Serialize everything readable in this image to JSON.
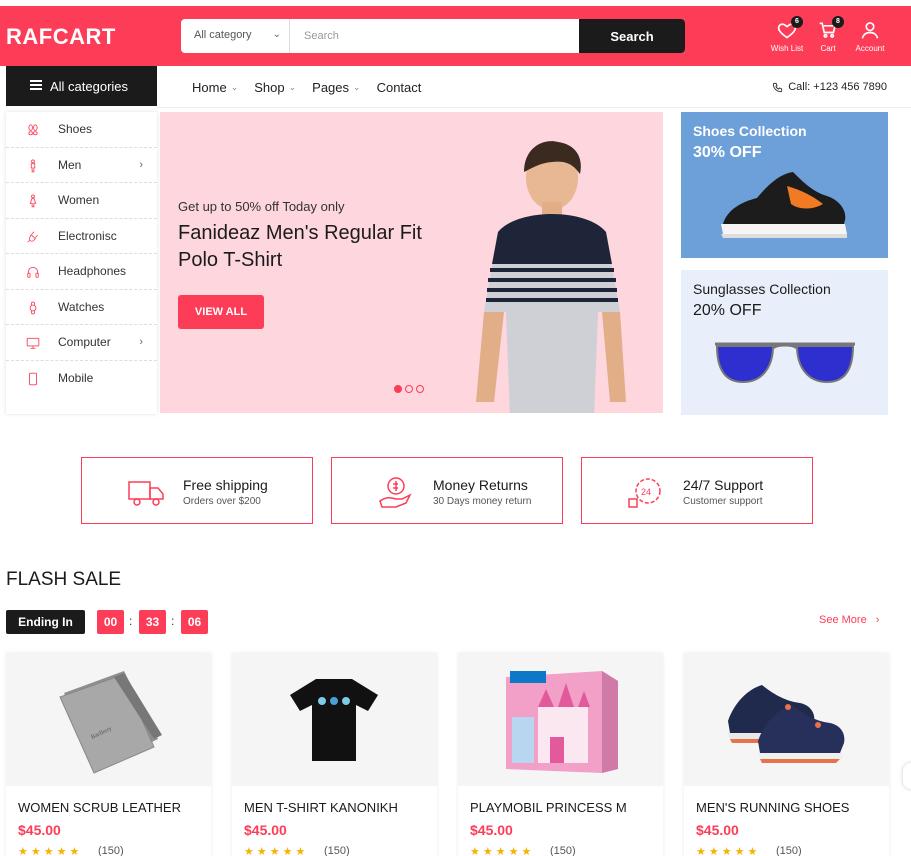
{
  "header": {
    "logo": "RAFCART",
    "category_select": "All category",
    "search_placeholder": "Search",
    "search_button": "Search",
    "wishlist": {
      "label": "Wish List",
      "count": "6"
    },
    "cart": {
      "label": "Cart",
      "count": "8"
    },
    "account": {
      "label": "Account"
    }
  },
  "nav": {
    "all_categories": "All categories",
    "items": [
      "Home",
      "Shop",
      "Pages",
      "Contact"
    ],
    "phone": "Call: +123 456 7890"
  },
  "sidebar": {
    "items": [
      {
        "label": "Shoes",
        "icon": "shoes-icon"
      },
      {
        "label": "Men",
        "icon": "man-icon",
        "has_submenu": true
      },
      {
        "label": "Women",
        "icon": "woman-icon"
      },
      {
        "label": "Electronisc",
        "icon": "plug-icon"
      },
      {
        "label": "Headphones",
        "icon": "headphones-icon"
      },
      {
        "label": "Watches",
        "icon": "watch-icon"
      },
      {
        "label": "Computer",
        "icon": "monitor-icon",
        "has_submenu": true
      },
      {
        "label": "Mobile",
        "icon": "mobile-icon"
      }
    ]
  },
  "hero": {
    "subtitle": "Get up to 50% off Today only",
    "title": "Fanideaz Men's Regular Fit Polo T-Shirt",
    "button": "VIEW ALL",
    "active_slide": 1,
    "slide_count": 3
  },
  "promos": [
    {
      "title": "Shoes Collection",
      "discount": "30% OFF",
      "bg": "#6d9fd8"
    },
    {
      "title": "Sunglasses Collection",
      "discount": "20% OFF",
      "bg": "#e9effa"
    }
  ],
  "features": [
    {
      "title": "Free shipping",
      "subtitle": "Orders over $200",
      "icon": "truck-icon"
    },
    {
      "title": "Money Returns",
      "subtitle": "30 Days money return",
      "icon": "money-return-icon"
    },
    {
      "title": "24/7 Support",
      "subtitle": "Customer support",
      "icon": "support-24-icon"
    }
  ],
  "flash_sale": {
    "title": "FLASH SALE",
    "ending_label": "Ending In",
    "timer": {
      "hours": "00",
      "minutes": "33",
      "seconds": "06"
    },
    "see_more": "See More",
    "products": [
      {
        "name": "WOMEN SCRUB LEATHER",
        "price": "$45.00",
        "reviews": "(150)",
        "rating": 5
      },
      {
        "name": "MEN T-SHIRT KANONIKH",
        "price": "$45.00",
        "reviews": "(150)",
        "rating": 5
      },
      {
        "name": "PLAYMOBIL PRINCESS M",
        "price": "$45.00",
        "reviews": "(150)",
        "rating": 5
      },
      {
        "name": "MEN'S RUNNING SHOES",
        "price": "$45.00",
        "reviews": "(150)",
        "rating": 5
      }
    ]
  },
  "colors": {
    "accent": "#fd3d57",
    "dark": "#1b1b1b"
  }
}
